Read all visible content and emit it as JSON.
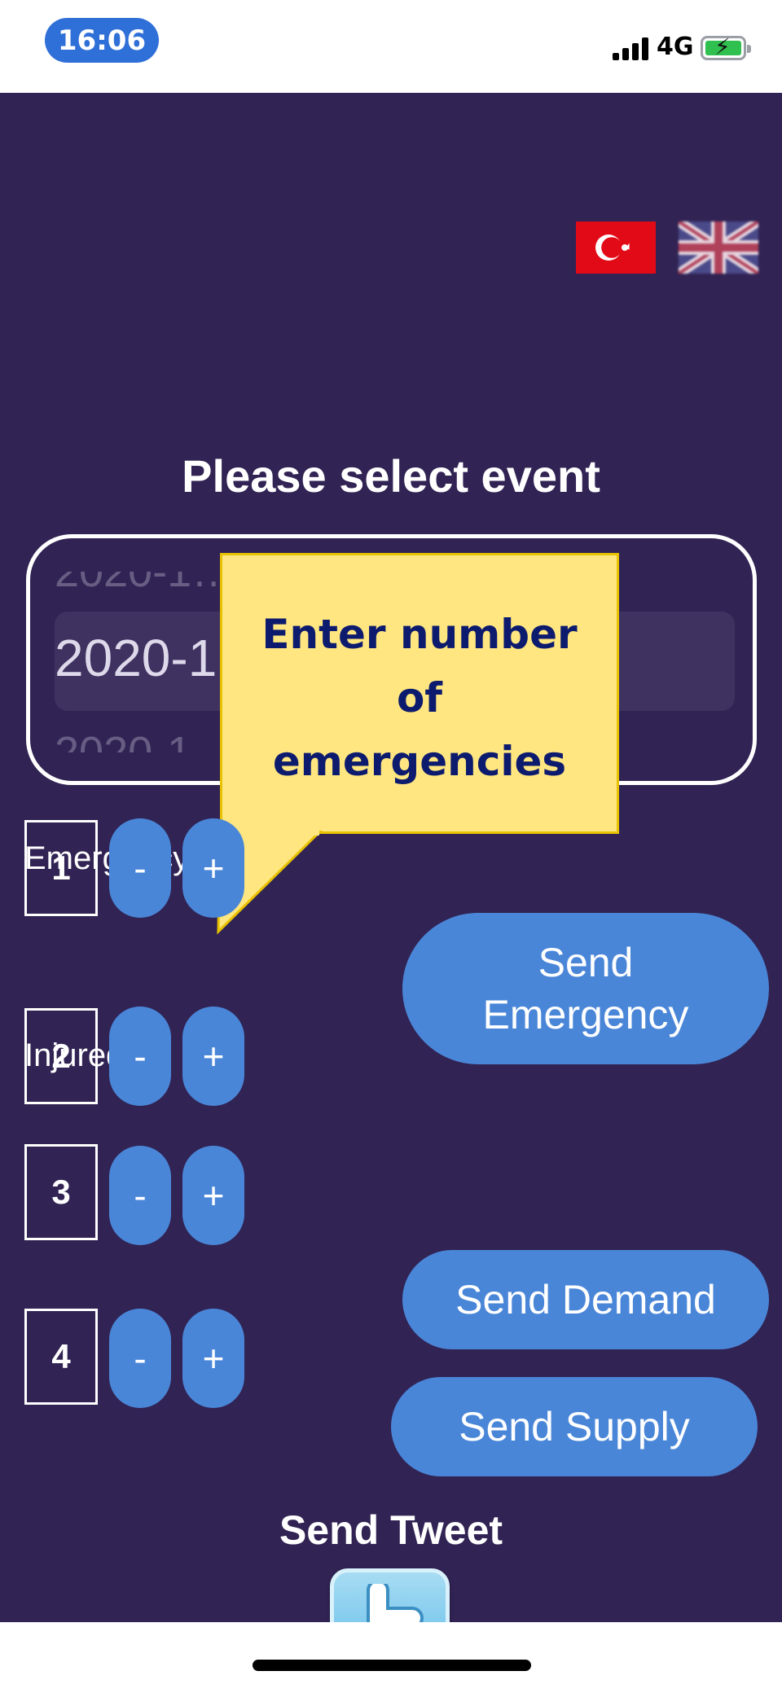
{
  "status_bar": {
    "time": "16:06",
    "network": "4G"
  },
  "languages": [
    {
      "icon": "turkey-flag-icon"
    },
    {
      "icon": "uk-flag-icon"
    }
  ],
  "event_picker": {
    "title": "Please select event",
    "rows": [
      "2020-1… …RE…",
      "2020-1… …thQ…",
      "2020-1… …thQ…"
    ]
  },
  "tooltip": {
    "text_line1": "Enter number",
    "text_line2": "of",
    "text_line3": "emergencies"
  },
  "labels": {
    "emergency": "Emergency",
    "injured": "Injured"
  },
  "counters": [
    {
      "value": "1",
      "minus": "-",
      "plus": "+"
    },
    {
      "value": "2",
      "minus": "-",
      "plus": "+"
    },
    {
      "value": "3",
      "minus": "-",
      "plus": "+"
    },
    {
      "value": "4",
      "minus": "-",
      "plus": "+"
    }
  ],
  "actions": {
    "send_emergency_line1": "Send",
    "send_emergency_line2": "Emergency",
    "send_demand": "Send Demand",
    "send_supply": "Send Supply",
    "send_tweet": "Send Tweet"
  },
  "colors": {
    "background": "#312353",
    "button": "#4a86d8",
    "tooltip_bg": "#ffe680",
    "tooltip_text": "#0d1b6e"
  }
}
